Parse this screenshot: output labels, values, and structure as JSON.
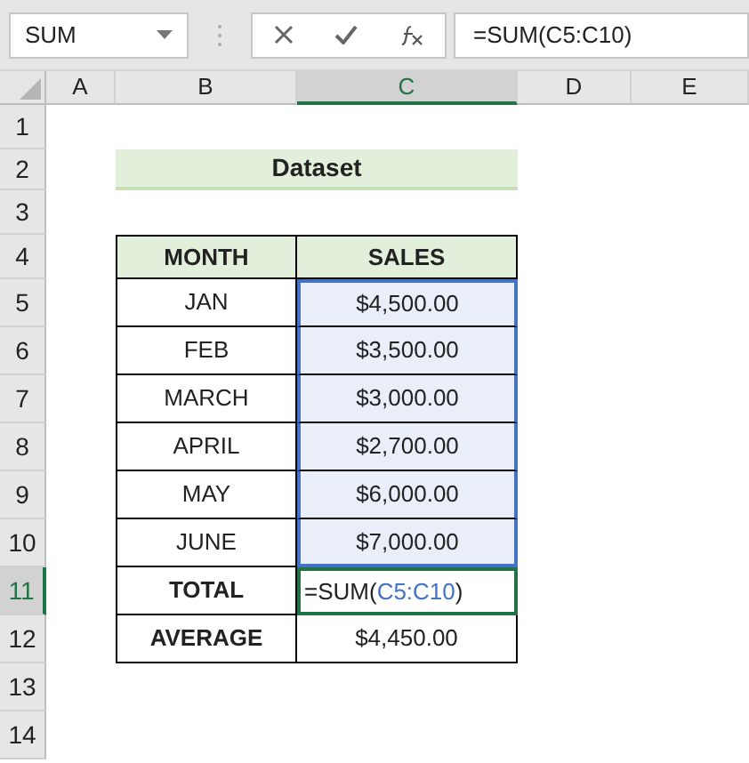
{
  "name_box": "SUM",
  "formula_bar": "=SUM(C5:C10)",
  "columns": [
    {
      "label": "A",
      "selected": false
    },
    {
      "label": "B",
      "selected": false
    },
    {
      "label": "C",
      "selected": true
    },
    {
      "label": "D",
      "selected": false
    },
    {
      "label": "E",
      "selected": false
    }
  ],
  "rows": [
    {
      "label": "1",
      "selected": false
    },
    {
      "label": "2",
      "selected": false
    },
    {
      "label": "3",
      "selected": false
    },
    {
      "label": "4",
      "selected": false
    },
    {
      "label": "5",
      "selected": false
    },
    {
      "label": "6",
      "selected": false
    },
    {
      "label": "7",
      "selected": false
    },
    {
      "label": "8",
      "selected": false
    },
    {
      "label": "9",
      "selected": false
    },
    {
      "label": "10",
      "selected": false
    },
    {
      "label": "11",
      "selected": true
    },
    {
      "label": "12",
      "selected": false
    },
    {
      "label": "13",
      "selected": false
    },
    {
      "label": "14",
      "selected": false
    }
  ],
  "title": "Dataset",
  "table": {
    "headers": [
      "MONTH",
      "SALES"
    ],
    "rows": [
      {
        "month": "JAN",
        "sales": "$4,500.00",
        "in_range": true
      },
      {
        "month": "FEB",
        "sales": "$3,500.00",
        "in_range": true
      },
      {
        "month": "MARCH",
        "sales": "$3,000.00",
        "in_range": true
      },
      {
        "month": "APRIL",
        "sales": "$2,700.00",
        "in_range": true
      },
      {
        "month": "MAY",
        "sales": "$6,000.00",
        "in_range": true
      },
      {
        "month": "JUNE",
        "sales": "$7,000.00",
        "in_range": true
      }
    ],
    "total": {
      "label": "TOTAL",
      "formula_parts": [
        {
          "text": "=SUM(",
          "kind": "plain"
        },
        {
          "text": "C5:C10",
          "kind": "ref"
        },
        {
          "text": ")",
          "kind": "plain"
        }
      ]
    },
    "average": {
      "label": "AVERAGE",
      "value": "$4,450.00"
    }
  }
}
